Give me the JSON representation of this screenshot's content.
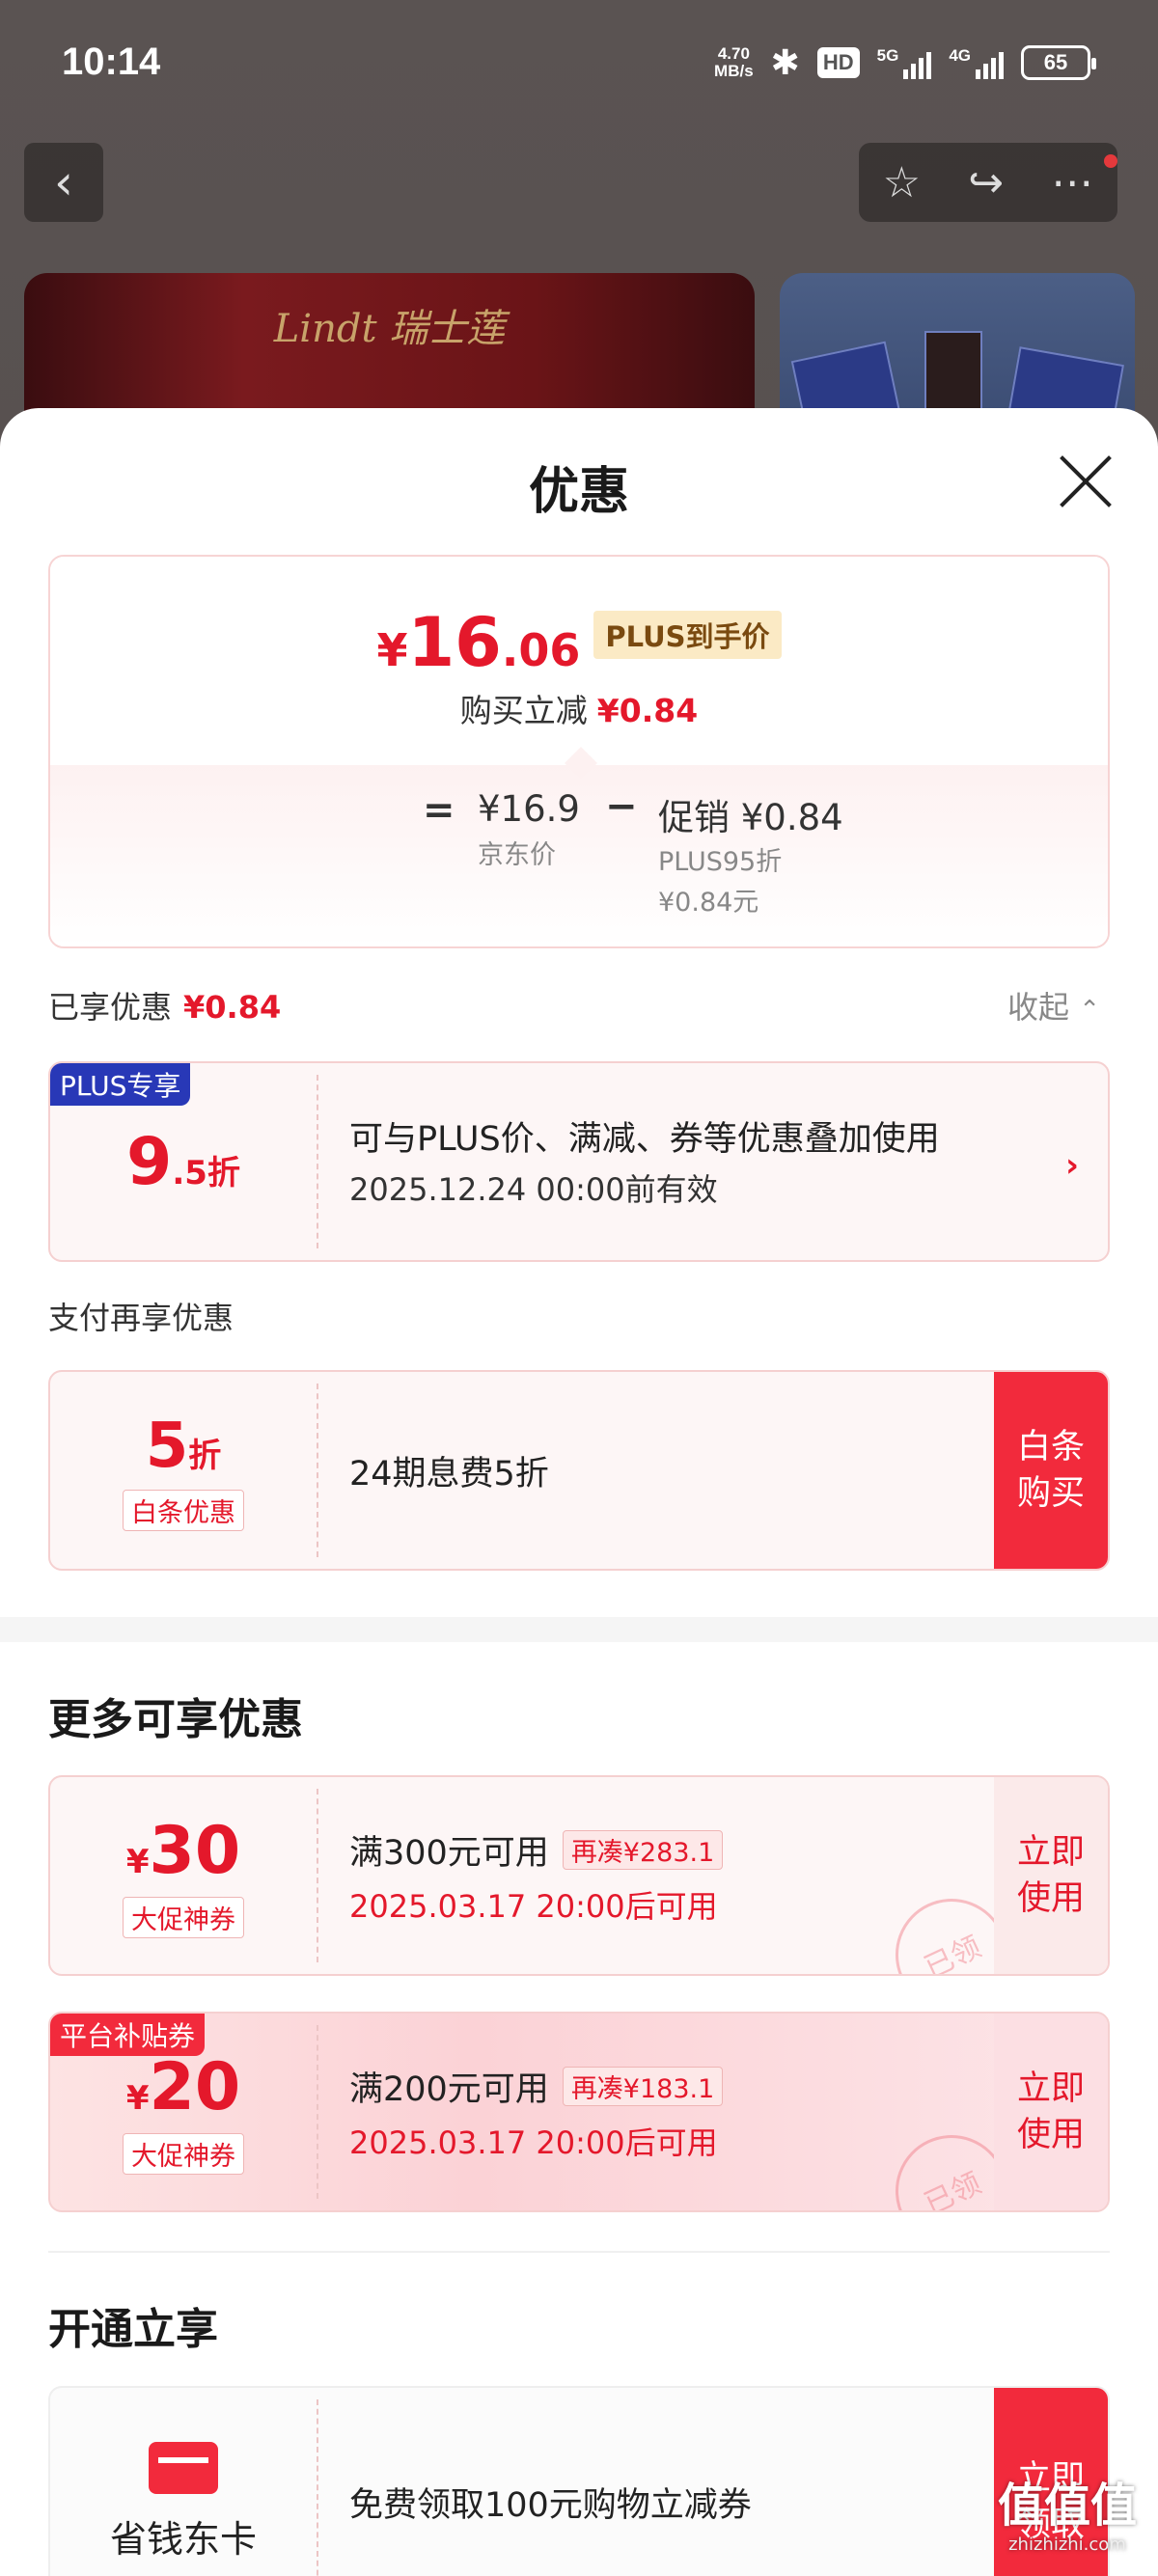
{
  "status": {
    "time": "10:14",
    "speed_value": "4.70",
    "speed_unit": "MB/s",
    "hd": "HD",
    "net1": "5G",
    "net2": "4G",
    "battery": "65"
  },
  "banner": {
    "brand": "Lindt 瑞士莲"
  },
  "sheet": {
    "title": "优惠"
  },
  "price": {
    "yen": "¥",
    "int": "16",
    "dec": ".06",
    "plus_label": "PLUS到手价",
    "subtitle": "购买立减",
    "subtitle_amount": "¥0.84",
    "eq": "=",
    "jd_value": "¥16.9",
    "jd_label": "京东价",
    "minus": "−",
    "promo_value": "促销 ¥0.84",
    "promo_line1": "PLUS95折",
    "promo_line2": "¥0.84元"
  },
  "enjoyed": {
    "label": "已享优惠",
    "amount": "¥0.84",
    "collapse": "收起"
  },
  "plus_coupon": {
    "tag": "PLUS专享",
    "num": "9",
    "suffix": ".5折",
    "desc": "可与PLUS价、满减、券等优惠叠加使用",
    "valid": "2025.12.24 00:00前有效",
    "arrow": "›"
  },
  "pay": {
    "label": "支付再享优惠",
    "num": "5",
    "suffix": "折",
    "badge": "白条优惠",
    "desc": "24期息费5折",
    "button": "白条购买"
  },
  "more": {
    "title": "更多可享优惠",
    "coupons": [
      {
        "tag": "",
        "yen": "¥",
        "amount": "30",
        "badge": "大促神券",
        "cond": "满300元可用",
        "chip": "再凑¥283.1",
        "valid": "2025.03.17 20:00后可用",
        "button": "立即使用",
        "stamp": "已领"
      },
      {
        "tag": "平台补贴券",
        "yen": "¥",
        "amount": "20",
        "badge": "大促神券",
        "cond": "满200元可用",
        "chip": "再凑¥183.1",
        "valid": "2025.03.17 20:00后可用",
        "button": "立即使用",
        "stamp": "已领"
      }
    ]
  },
  "open": {
    "title": "开通立享",
    "card_name": "省钱东卡",
    "desc": "免费领取100元购物立减券",
    "button": "立即领取"
  },
  "watermark": {
    "big": "值值值",
    "small": "zhizhizhi.com"
  },
  "colors": {
    "accent": "#e4182b",
    "button": "#f22a3c",
    "plus_tag": "#2838b7",
    "plus_price_bg": "#fbeac5"
  }
}
